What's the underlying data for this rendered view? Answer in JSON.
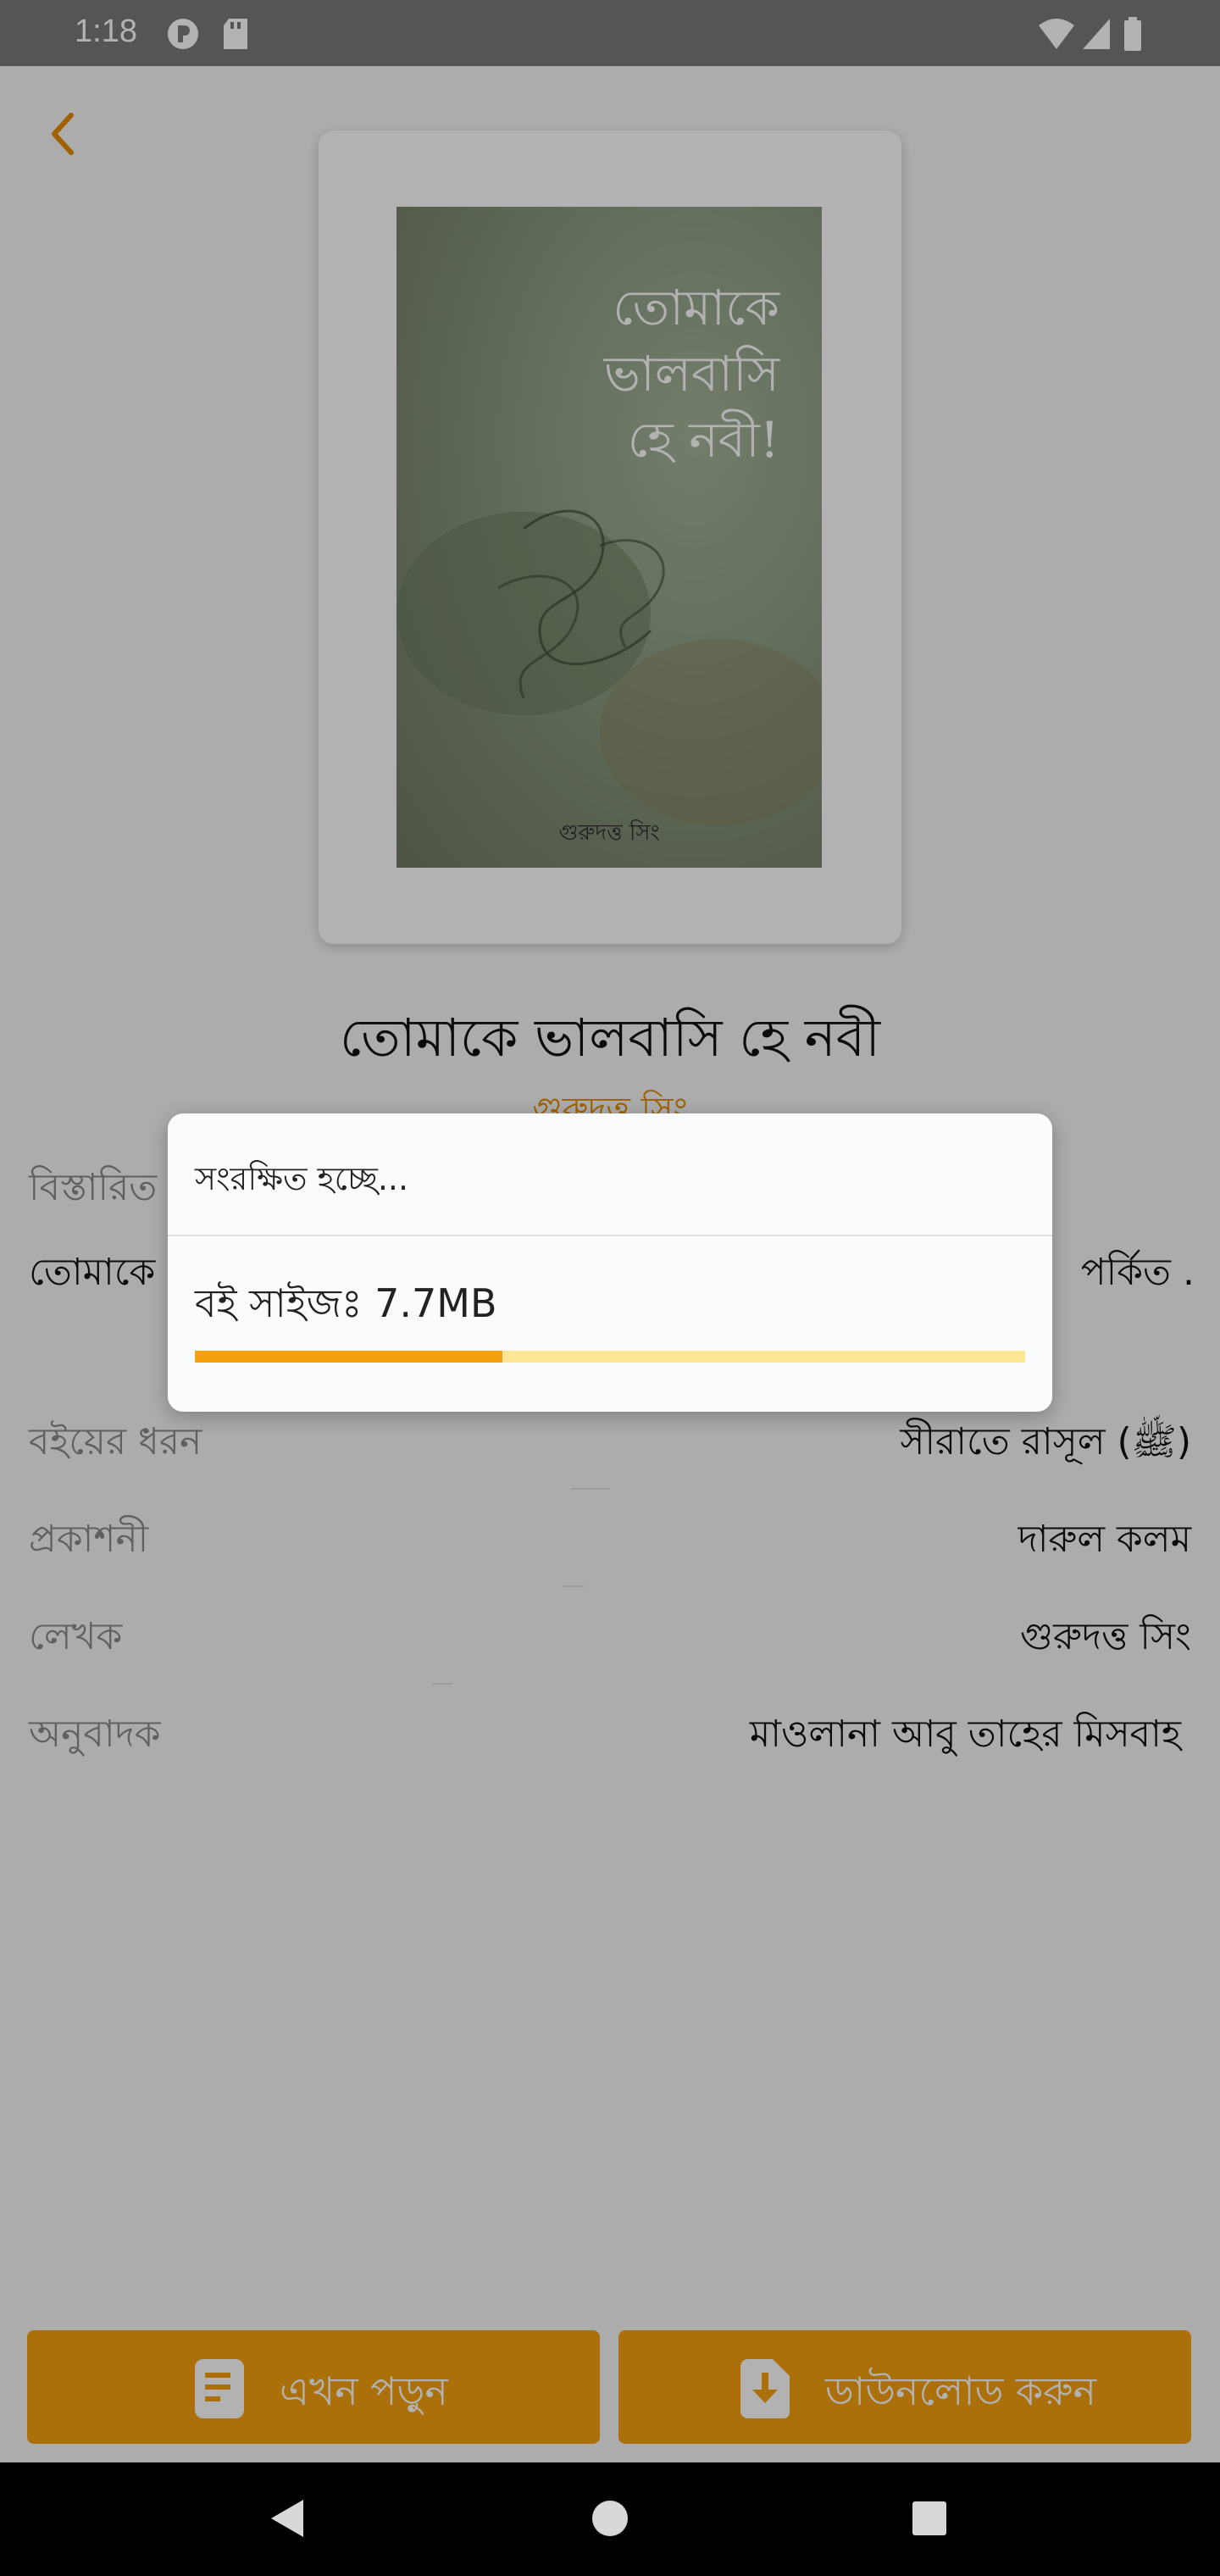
{
  "status_bar": {
    "time": "1:18"
  },
  "book": {
    "cover_title": "তোমাকে\nভালবাসি\nহে নবী!",
    "cover_author": "গুরুদত্ত সিং",
    "title": "তোমাকে ভালবাসি হে নবী",
    "author": "গুরুদত্ত সিং"
  },
  "details": {
    "heading": "বিস্তারিত",
    "description_left": "তোমাকে",
    "description_right": "পর্কিত .",
    "rows": [
      {
        "label": "বইয়ের ধরন",
        "value": "সীরাতে রাসূল (ﷺ)"
      },
      {
        "label": "প্রকাশনী",
        "value": "দারুল কলম"
      },
      {
        "label": "লেখক",
        "value": "গুরুদত্ত সিং"
      },
      {
        "label": "অনুবাদক",
        "value": "মাওলানা আবু তাহের মিসবাহ"
      }
    ]
  },
  "dialog": {
    "title": "সংরক্ষিত হচ্ছে...",
    "size_text": "বই সাইজঃ 7.7MB",
    "progress": 0.37
  },
  "actions": {
    "read_now": "এখন পড়ুন",
    "download": "ডাউনলোড করুন"
  },
  "colors": {
    "accent": "#f5a10f",
    "accent_light": "#ffe694",
    "link": "#e58b00"
  }
}
